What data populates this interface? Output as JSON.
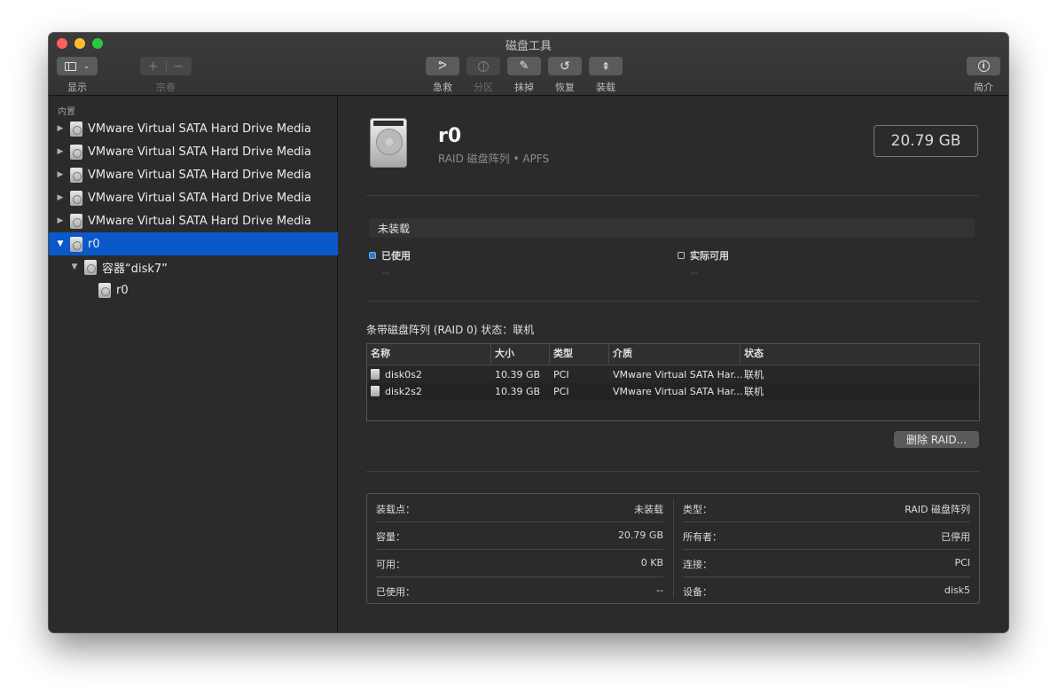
{
  "window": {
    "title": "磁盘工具"
  },
  "toolbar": {
    "view_label": "显示",
    "volume_label": "宗卷",
    "firstaid_label": "急救",
    "partition_label": "分区",
    "erase_label": "抹掉",
    "restore_label": "恢复",
    "mount_label": "装载",
    "info_label": "简介"
  },
  "sidebar": {
    "section": "内置",
    "items": [
      {
        "label": "VMware Virtual SATA Hard Drive Media"
      },
      {
        "label": "VMware Virtual SATA Hard Drive Media"
      },
      {
        "label": "VMware Virtual SATA Hard Drive Media"
      },
      {
        "label": "VMware Virtual SATA Hard Drive Media"
      },
      {
        "label": "VMware Virtual SATA Hard Drive Media"
      },
      {
        "label": "r0"
      },
      {
        "label": "容器“disk7”"
      },
      {
        "label": "r0"
      }
    ]
  },
  "volume": {
    "name": "r0",
    "subtitle": "RAID 磁盘阵列 • APFS",
    "size": "20.79 GB",
    "mount_status": "未装载",
    "used_label": "已使用",
    "used_value": "--",
    "free_label": "实际可用",
    "free_value": "--"
  },
  "raid": {
    "title": "条带磁盘阵列 (RAID 0) 状态：联机",
    "columns": [
      "名称",
      "大小",
      "类型",
      "介质",
      "状态"
    ],
    "rows": [
      {
        "name": "disk0s2",
        "size": "10.39 GB",
        "type": "PCI",
        "media": "VMware Virtual SATA Har...",
        "status": "联机"
      },
      {
        "name": "disk2s2",
        "size": "10.39 GB",
        "type": "PCI",
        "media": "VMware Virtual SATA Har...",
        "status": "联机"
      }
    ],
    "delete_label": "删除 RAID..."
  },
  "info": {
    "left": [
      {
        "k": "装载点：",
        "v": "未装载"
      },
      {
        "k": "容量：",
        "v": "20.79 GB"
      },
      {
        "k": "可用：",
        "v": "0 KB"
      },
      {
        "k": "已使用：",
        "v": "--"
      }
    ],
    "right": [
      {
        "k": "类型：",
        "v": "RAID 磁盘阵列"
      },
      {
        "k": "所有者：",
        "v": "已停用"
      },
      {
        "k": "连接：",
        "v": "PCI"
      },
      {
        "k": "设备：",
        "v": "disk5"
      }
    ]
  },
  "colors": {
    "selection": "#0a58ca",
    "used_dot": "#2f7fcf"
  }
}
